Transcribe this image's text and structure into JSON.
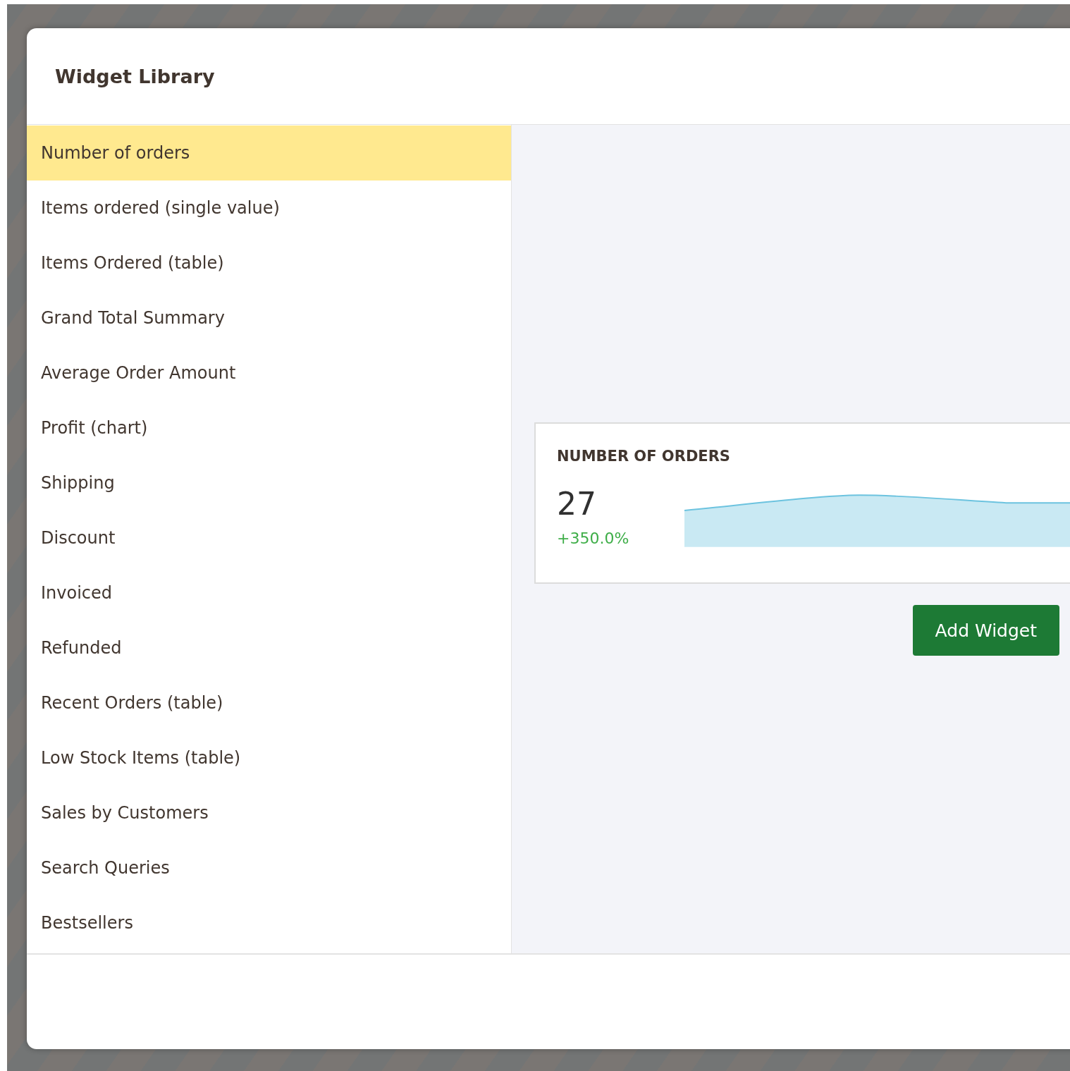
{
  "dialog": {
    "title": "Widget Library"
  },
  "widgets": [
    {
      "label": "Number of orders",
      "selected": true
    },
    {
      "label": "Items ordered (single value)",
      "selected": false
    },
    {
      "label": "Items Ordered (table)",
      "selected": false
    },
    {
      "label": "Grand Total Summary",
      "selected": false
    },
    {
      "label": "Average Order Amount",
      "selected": false
    },
    {
      "label": "Profit (chart)",
      "selected": false
    },
    {
      "label": "Shipping",
      "selected": false
    },
    {
      "label": "Discount",
      "selected": false
    },
    {
      "label": "Invoiced",
      "selected": false
    },
    {
      "label": "Refunded",
      "selected": false
    },
    {
      "label": "Recent Orders (table)",
      "selected": false
    },
    {
      "label": "Low Stock Items (table)",
      "selected": false
    },
    {
      "label": "Sales by Customers",
      "selected": false
    },
    {
      "label": "Search Queries",
      "selected": false
    },
    {
      "label": "Bestsellers",
      "selected": false
    }
  ],
  "preview": {
    "title": "NUMBER OF ORDERS",
    "value": "27",
    "change": "+350.0%"
  },
  "add_button": "Add Widget"
}
